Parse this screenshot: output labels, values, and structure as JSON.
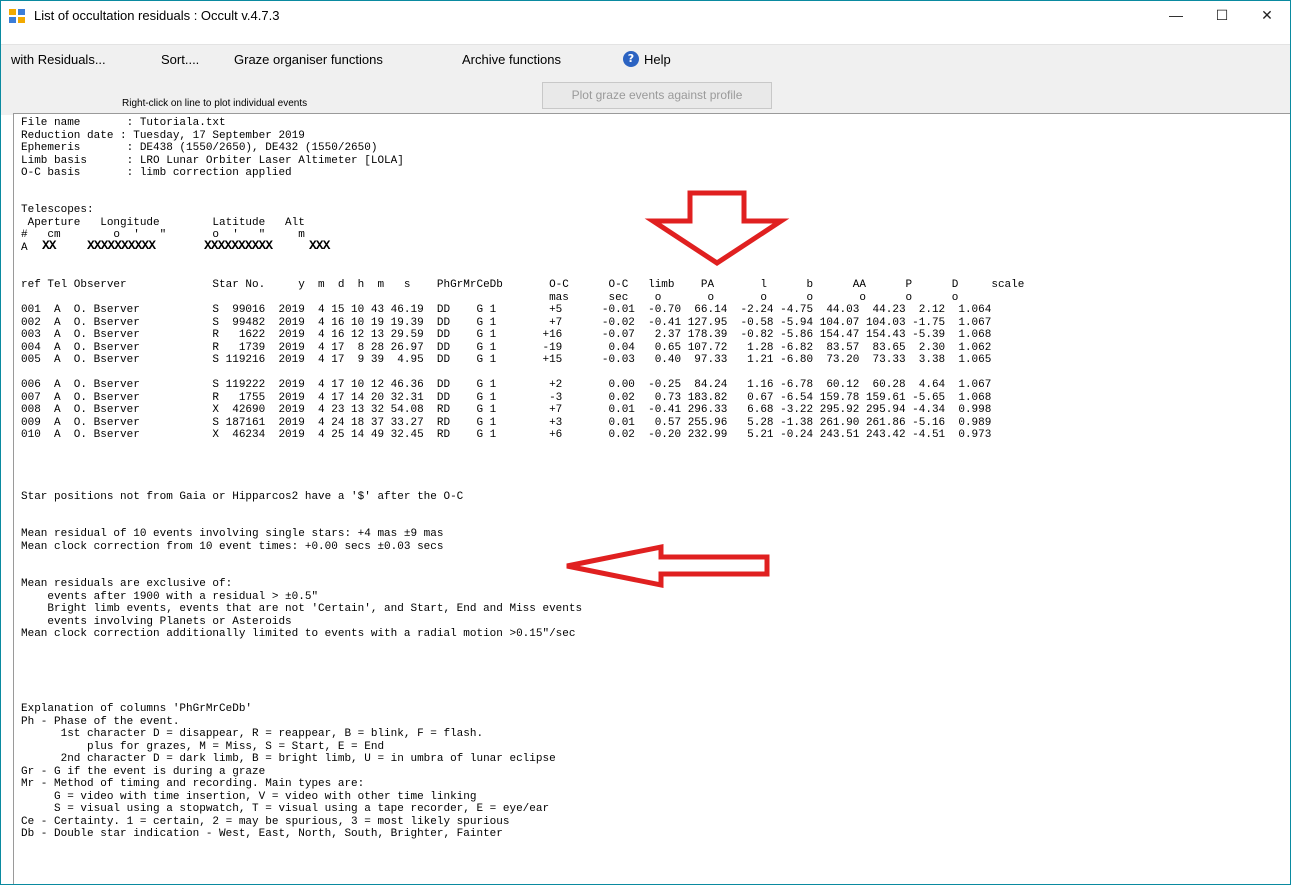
{
  "window": {
    "title": "List of occultation residuals : Occult v.4.7.3",
    "buttons": [
      "—",
      "☐",
      "✕"
    ]
  },
  "menu": {
    "items": [
      "with Residuals...",
      "Sort....",
      "Graze organiser functions",
      "Archive functions"
    ],
    "help": "Help"
  },
  "toolbar": {
    "hint": "Right-click on line to plot individual events",
    "plot_button": "Plot graze events against profile"
  },
  "header": {
    "file_name": "File name       : Tutoriala.txt",
    "reduction_date": "Reduction date : Tuesday, 17 September 2019",
    "ephemeris": "Ephemeris       : DE438 (1550/2650), DE432 (1550/2650)",
    "limb_basis": "Limb basis      : LRO Lunar Orbiter Laser Altimeter [LOLA]",
    "oc_basis": "O-C basis       : limb correction applied"
  },
  "telescopes": {
    "title": "Telescopes:",
    "head1": " Aperture   Longitude        Latitude   Alt",
    "head2": "#   cm        o  '   \"       o  '   \"     m",
    "row_prefix": "A  ",
    "aperture": "XX",
    "longitude": "XXXXXXXXXX",
    "latitude": "XXXXXXXXXX",
    "alt": "XXX"
  },
  "table": {
    "header1": "ref Tel Observer             Star No.     y  m  d  h  m   s    PhGrMrCeDb       O-C      O-C   limb    PA       l      b      AA      P      D     scale",
    "header2": "                                                                                mas      sec    o       o       o      o       o      o      o",
    "rows": [
      "001  A  O. Bserver           S  99016  2019  4 15 10 43 46.19  DD    G 1        +5      -0.01  -0.70  66.14  -2.24 -4.75  44.03  44.23  2.12  1.064",
      "002  A  O. Bserver           S  99482  2019  4 16 10 19 19.39  DD    G 1        +7      -0.02  -0.41 127.95  -0.58 -5.94 104.07 104.03 -1.75  1.067",
      "003  A  O. Bserver           R   1622  2019  4 16 12 13 29.59  DD    G 1       +16      -0.07   2.37 178.39  -0.82 -5.86 154.47 154.43 -5.39  1.068",
      "004  A  O. Bserver           R   1739  2019  4 17  8 28 26.97  DD    G 1       -19       0.04   0.65 107.72   1.28 -6.82  83.57  83.65  2.30  1.062",
      "005  A  O. Bserver           S 119216  2019  4 17  9 39  4.95  DD    G 1       +15      -0.03   0.40  97.33   1.21 -6.80  73.20  73.33  3.38  1.065",
      "",
      "006  A  O. Bserver           S 119222  2019  4 17 10 12 46.36  DD    G 1        +2       0.00  -0.25  84.24   1.16 -6.78  60.12  60.28  4.64  1.067",
      "007  A  O. Bserver           R   1755  2019  4 17 14 20 32.31  DD    G 1        -3       0.02   0.73 183.82   0.67 -6.54 159.78 159.61 -5.65  1.068",
      "008  A  O. Bserver           X  42690  2019  4 23 13 32 54.08  RD    G 1        +7       0.01  -0.41 296.33   6.68 -3.22 295.92 295.94 -4.34  0.998",
      "009  A  O. Bserver           S 187161  2019  4 24 18 37 33.27  RD    G 1        +3       0.01   0.57 255.96   5.28 -1.38 261.90 261.86 -5.16  0.989",
      "010  A  O. Bserver           X  46234  2019  4 25 14 49 32.45  RD    G 1        +6       0.02  -0.20 232.99   5.21 -0.24 243.51 243.42 -4.51  0.973"
    ]
  },
  "notes": {
    "star_positions": "Star positions not from Gaia or Hipparcos2 have a '$' after the O-C",
    "mean_residual": "Mean residual of 10 events involving single stars: +4 mas ±9 mas",
    "mean_clock": "Mean clock correction from 10 event times: +0.00 secs ±0.03 secs",
    "exclusive": [
      "Mean residuals are exclusive of:",
      "    events after 1900 with a residual > ±0.5\"",
      "    Bright limb events, events that are not 'Certain', and Start, End and Miss events",
      "    events involving Planets or Asteroids",
      "Mean clock correction additionally limited to events with a radial motion >0.15\"/sec"
    ],
    "explanation": [
      "Explanation of columns 'PhGrMrCeDb'",
      "Ph - Phase of the event.",
      "      1st character D = disappear, R = reappear, B = blink, F = flash.",
      "          plus for grazes, M = Miss, S = Start, E = End",
      "      2nd character D = dark limb, B = bright limb, U = in umbra of lunar eclipse",
      "Gr - G if the event is during a graze",
      "Mr - Method of timing and recording. Main types are:",
      "     G = video with time insertion, V = video with other time linking",
      "     S = visual using a stopwatch, T = visual using a tape recorder, E = eye/ear",
      "Ce - Certainty. 1 = certain, 2 = may be spurious, 3 = most likely spurious",
      "Db - Double star indication - West, East, North, South, Brighter, Fainter"
    ]
  },
  "colors": {
    "arrow": "#e02020",
    "menu_bg": "#f0f0f0",
    "border": "#0a8aa0"
  }
}
